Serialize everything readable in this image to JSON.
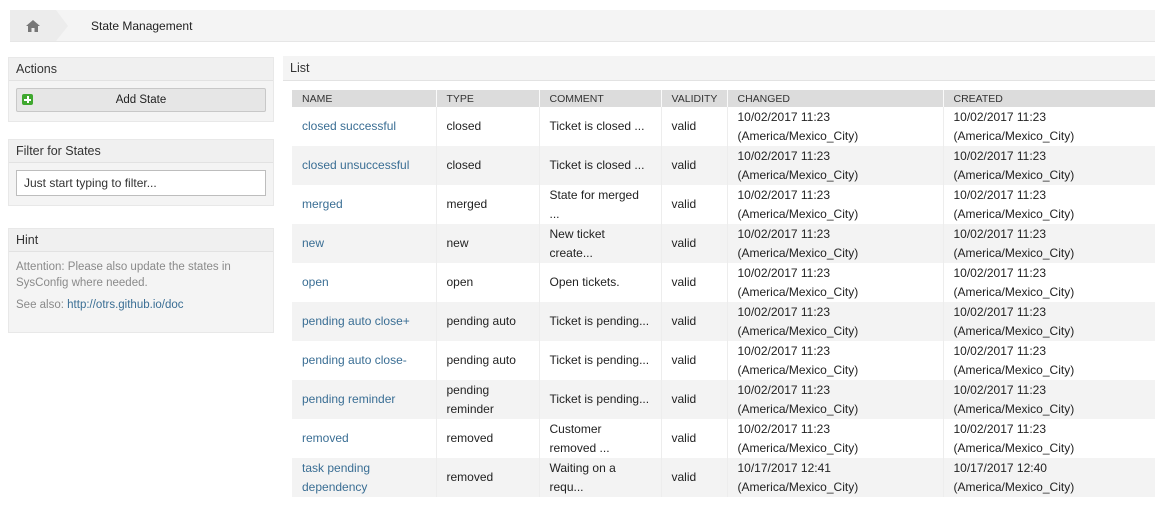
{
  "breadcrumb": {
    "home_icon": "home-icon",
    "current": "State Management"
  },
  "sidebar": {
    "actions": {
      "title": "Actions",
      "add_label": "Add State",
      "add_icon": "plus-icon"
    },
    "filter": {
      "title": "Filter for States",
      "placeholder": "Just start typing to filter..."
    },
    "hint": {
      "title": "Hint",
      "text": "Attention: Please also update the states in SysConfig where needed.",
      "see_also_prefix": "See also: ",
      "link": "http://otrs.github.io/doc"
    }
  },
  "list": {
    "title": "List",
    "columns": [
      "NAME",
      "TYPE",
      "COMMENT",
      "VALIDITY",
      "CHANGED",
      "CREATED"
    ],
    "rows": [
      {
        "name": "closed successful",
        "type": "closed",
        "comment": "Ticket is closed ...",
        "validity": "valid",
        "changed_date": "10/02/2017 11:23",
        "changed_tz": "(America/Mexico_City)",
        "created_date": "10/02/2017 11:23",
        "created_tz": "(America/Mexico_City)"
      },
      {
        "name": "closed unsuccessful",
        "type": "closed",
        "comment": "Ticket is closed ...",
        "validity": "valid",
        "changed_date": "10/02/2017 11:23",
        "changed_tz": "(America/Mexico_City)",
        "created_date": "10/02/2017 11:23",
        "created_tz": "(America/Mexico_City)"
      },
      {
        "name": "merged",
        "type": "merged",
        "comment": "State for merged ...",
        "validity": "valid",
        "changed_date": "10/02/2017 11:23",
        "changed_tz": "(America/Mexico_City)",
        "created_date": "10/02/2017 11:23",
        "created_tz": "(America/Mexico_City)"
      },
      {
        "name": "new",
        "type": "new",
        "comment": "New ticket create...",
        "validity": "valid",
        "changed_date": "10/02/2017 11:23",
        "changed_tz": "(America/Mexico_City)",
        "created_date": "10/02/2017 11:23",
        "created_tz": "(America/Mexico_City)"
      },
      {
        "name": "open",
        "type": "open",
        "comment": "Open tickets.",
        "validity": "valid",
        "changed_date": "10/02/2017 11:23",
        "changed_tz": "(America/Mexico_City)",
        "created_date": "10/02/2017 11:23",
        "created_tz": "(America/Mexico_City)"
      },
      {
        "name": "pending auto close+",
        "type": "pending auto",
        "comment": "Ticket is pending...",
        "validity": "valid",
        "changed_date": "10/02/2017 11:23",
        "changed_tz": "(America/Mexico_City)",
        "created_date": "10/02/2017 11:23",
        "created_tz": "(America/Mexico_City)"
      },
      {
        "name": "pending auto close-",
        "type": "pending auto",
        "comment": "Ticket is pending...",
        "validity": "valid",
        "changed_date": "10/02/2017 11:23",
        "changed_tz": "(America/Mexico_City)",
        "created_date": "10/02/2017 11:23",
        "created_tz": "(America/Mexico_City)"
      },
      {
        "name": "pending reminder",
        "type": "pending reminder",
        "comment": "Ticket is pending...",
        "validity": "valid",
        "changed_date": "10/02/2017 11:23",
        "changed_tz": "(America/Mexico_City)",
        "created_date": "10/02/2017 11:23",
        "created_tz": "(America/Mexico_City)"
      },
      {
        "name": "removed",
        "type": "removed",
        "comment": "Customer removed ...",
        "validity": "valid",
        "changed_date": "10/02/2017 11:23",
        "changed_tz": "(America/Mexico_City)",
        "created_date": "10/02/2017 11:23",
        "created_tz": "(America/Mexico_City)"
      },
      {
        "name": "task pending dependency",
        "type": "removed",
        "comment": "Waiting on a requ...",
        "validity": "valid",
        "changed_date": "10/17/2017 12:41",
        "changed_tz": "(America/Mexico_City)",
        "created_date": "10/17/2017 12:40",
        "created_tz": "(America/Mexico_City)"
      }
    ]
  }
}
